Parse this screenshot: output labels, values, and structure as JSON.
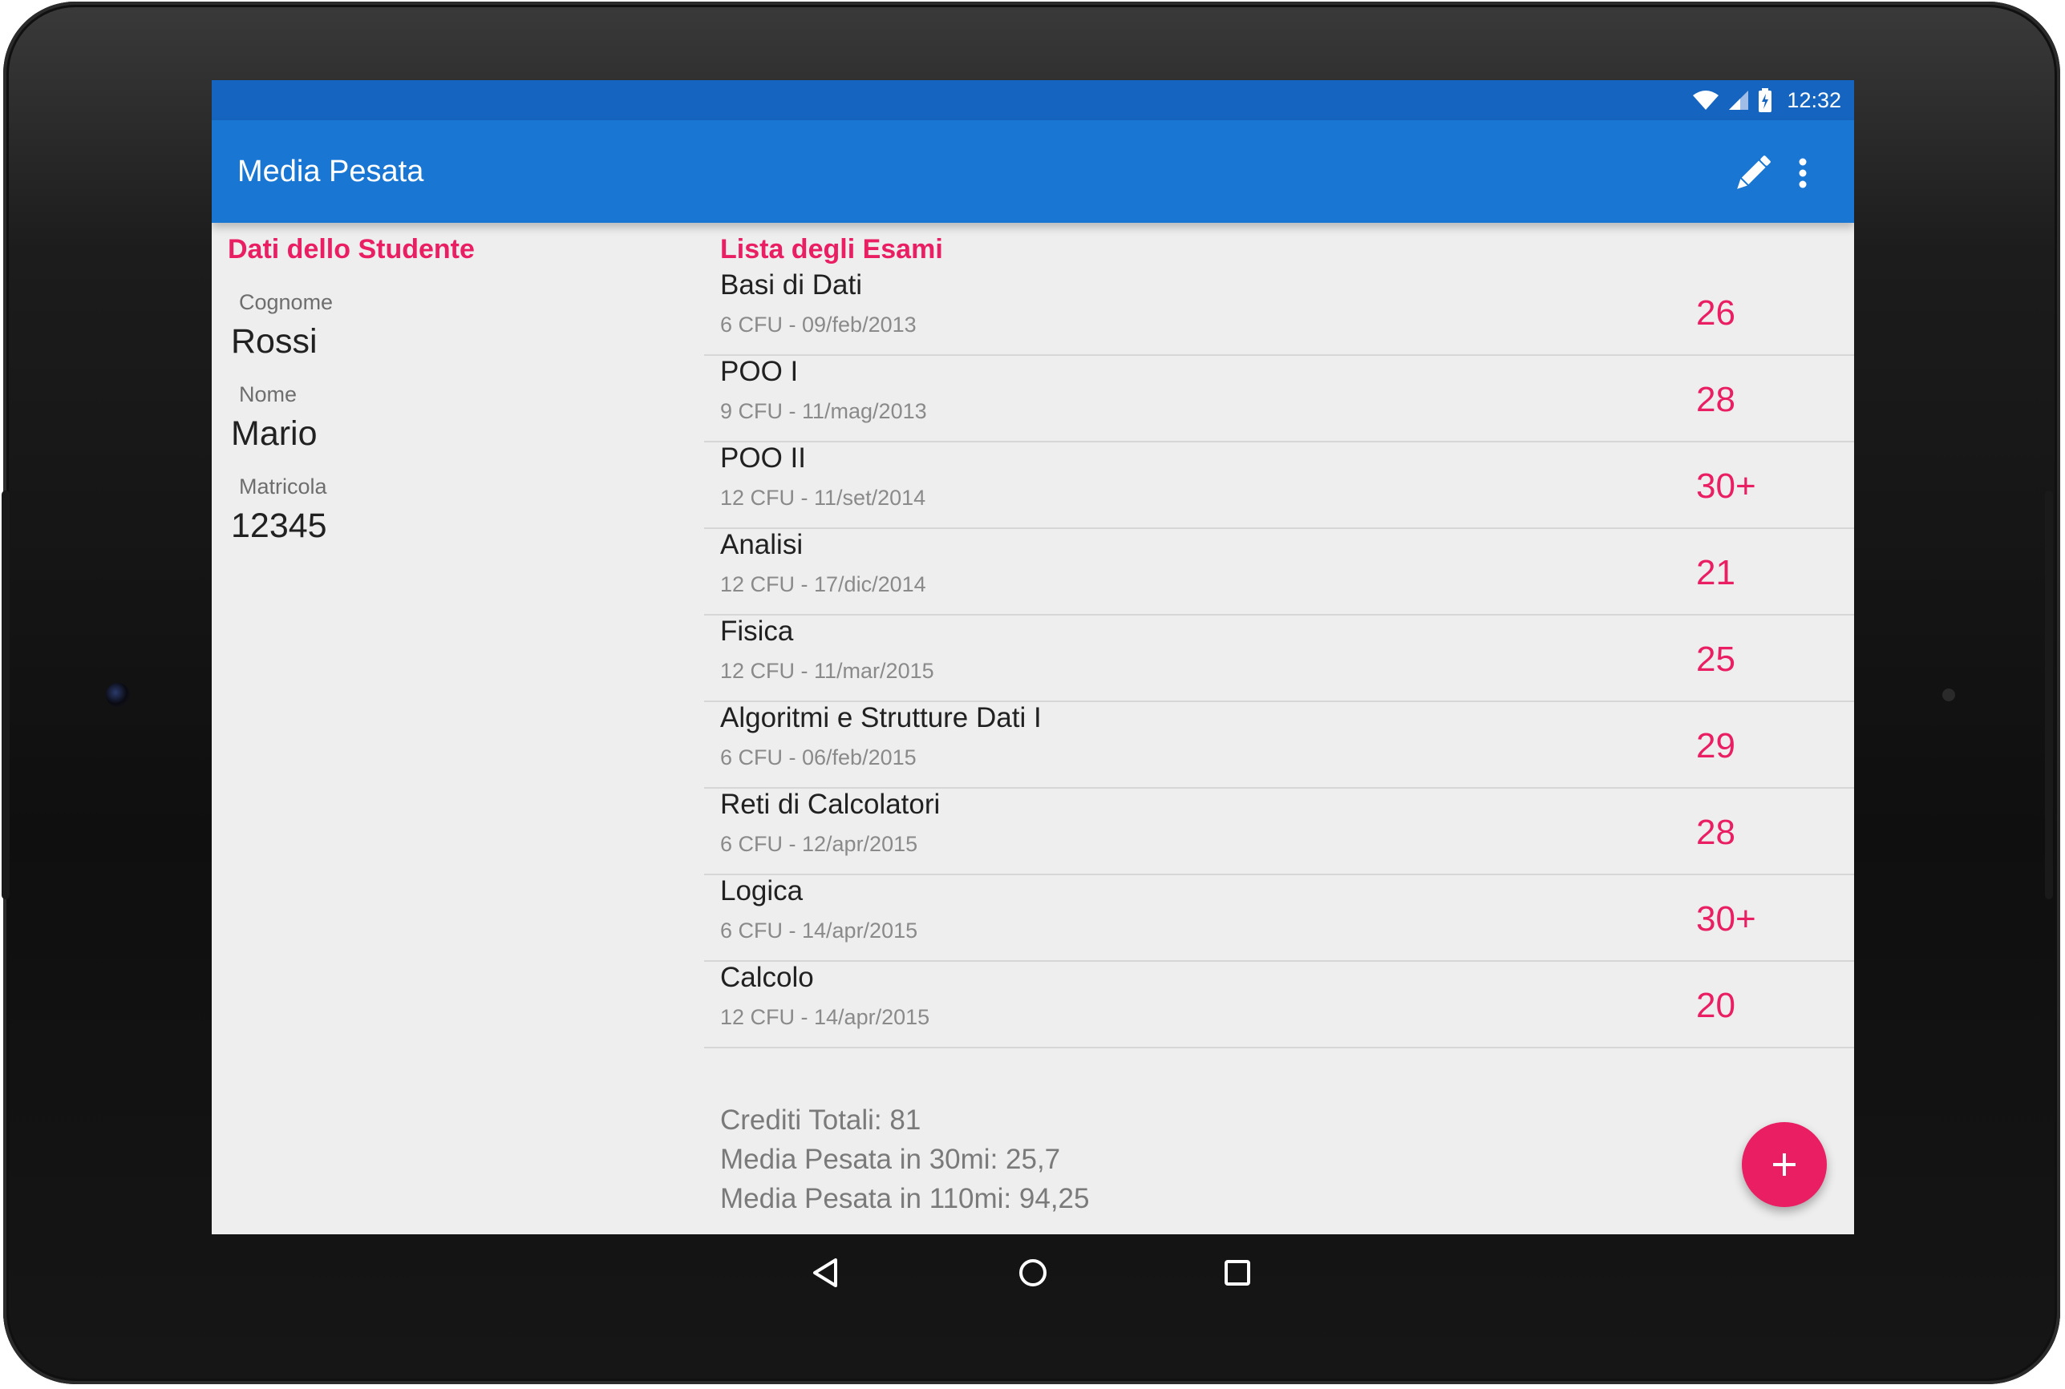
{
  "status_bar": {
    "time": "12:32",
    "icons": [
      "wifi-icon",
      "signal-icon",
      "battery-charging-icon"
    ]
  },
  "app_bar": {
    "title": "Media Pesata",
    "actions": [
      "edit-pencil-icon",
      "more-vert-icon"
    ]
  },
  "student": {
    "section_title": "Dati dello Studente",
    "surname_label": "Cognome",
    "surname_value": "Rossi",
    "name_label": "Nome",
    "name_value": "Mario",
    "id_label": "Matricola",
    "id_value": "12345"
  },
  "exams": {
    "section_title": "Lista degli Esami",
    "items": [
      {
        "name": "Basi di Dati",
        "detail": "6 CFU - 09/feb/2013",
        "grade": "26"
      },
      {
        "name": "POO I",
        "detail": "9 CFU - 11/mag/2013",
        "grade": "28"
      },
      {
        "name": "POO II",
        "detail": "12 CFU - 11/set/2014",
        "grade": "30+"
      },
      {
        "name": "Analisi",
        "detail": "12 CFU - 17/dic/2014",
        "grade": "21"
      },
      {
        "name": "Fisica",
        "detail": "12 CFU - 11/mar/2015",
        "grade": "25"
      },
      {
        "name": "Algoritmi e Strutture Dati I",
        "detail": "6 CFU - 06/feb/2015",
        "grade": "29"
      },
      {
        "name": "Reti di Calcolatori",
        "detail": "6 CFU - 12/apr/2015",
        "grade": "28"
      },
      {
        "name": "Logica",
        "detail": "6 CFU - 14/apr/2015",
        "grade": "30+"
      },
      {
        "name": "Calcolo",
        "detail": "12 CFU - 14/apr/2015",
        "grade": "20"
      }
    ]
  },
  "summary": {
    "total_credits": "Crediti Totali: 81",
    "average_30": "Media Pesata in 30mi: 25,7",
    "average_110": "Media Pesata in 110mi: 94,25"
  },
  "fab": {
    "icon": "plus-icon"
  },
  "nav_bar": {
    "icons": [
      "back-icon",
      "home-icon",
      "recents-icon"
    ]
  },
  "colors": {
    "status_bar": "#1565c0",
    "app_bar": "#1976d2",
    "accent": "#e91e63",
    "background": "#eeeeee"
  }
}
